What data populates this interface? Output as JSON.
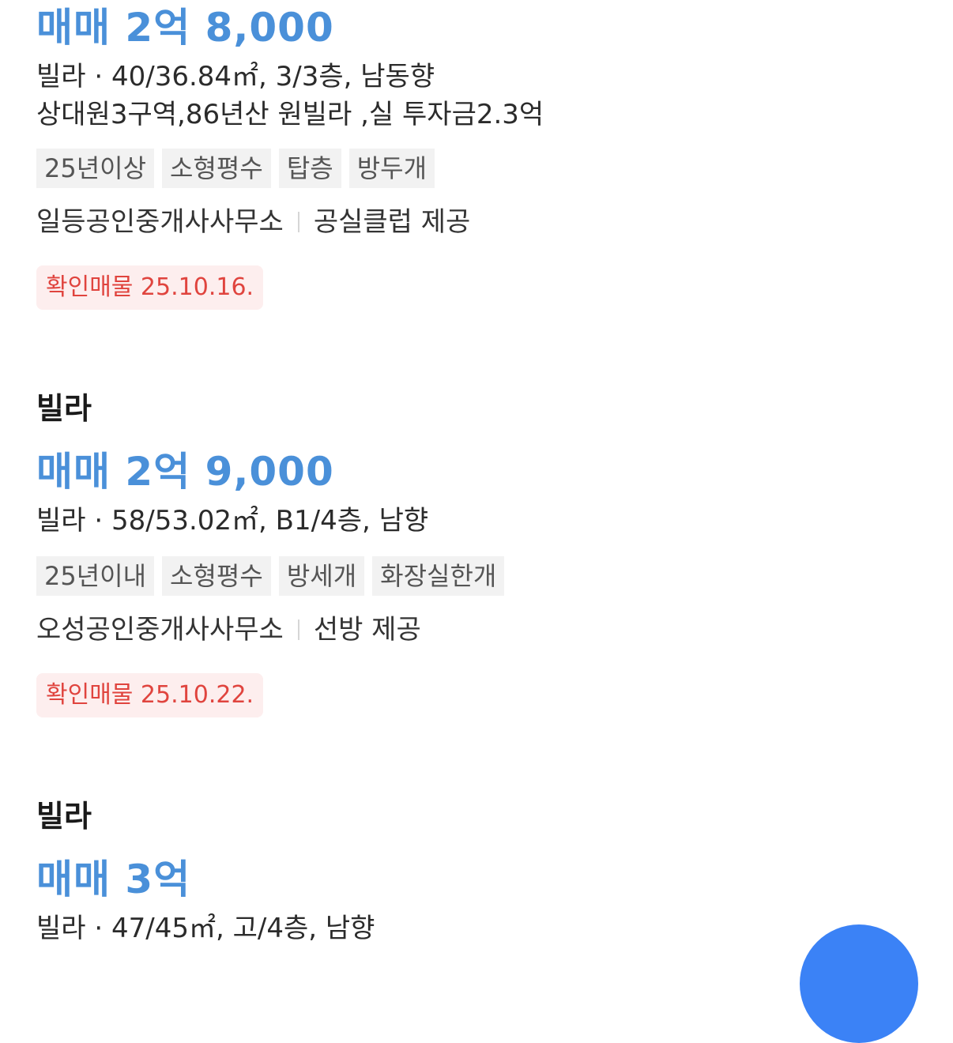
{
  "listings": [
    {
      "type_title": "",
      "price": "매매 2억 8,000",
      "spec": "빌라 · 40/36.84㎡, 3/3층, 남동향",
      "description": "상대원3구역,86년산 원빌라 ,실 투자금2.3억",
      "tags": [
        "25년이상",
        "소형평수",
        "탑층",
        "방두개"
      ],
      "agent": "일등공인중개사사무소",
      "provider": "공실클럽 제공",
      "verified": "확인매물 25.10.16."
    },
    {
      "type_title": "빌라",
      "price": "매매 2억 9,000",
      "spec": "빌라 · 58/53.02㎡, B1/4층, 남향",
      "tags": [
        "25년이내",
        "소형평수",
        "방세개",
        "화장실한개"
      ],
      "agent": "오성공인중개사사무소",
      "provider": "선방 제공",
      "verified": "확인매물 25.10.22."
    },
    {
      "type_title": "빌라",
      "price": "매매 3억",
      "spec": "빌라 · 47/45㎡, 고/4층, 남향"
    }
  ],
  "colors": {
    "price": "#4a90d9",
    "verified_text": "#e0443e",
    "verified_bg": "#fdeeee",
    "tag_bg": "#f2f2f2",
    "fab": "#3b82f6"
  }
}
